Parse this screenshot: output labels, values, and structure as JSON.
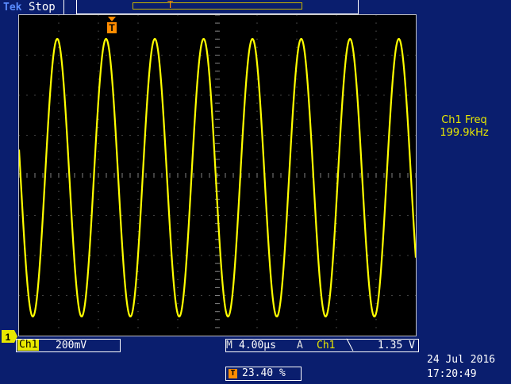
{
  "header": {
    "brand": "Tek",
    "run_status": "Stop",
    "record_marker": "T"
  },
  "display": {
    "trigger_marker": "T",
    "ch1_ground_marker": "1",
    "trace_color": "#ffff00",
    "grid_color": "#808080"
  },
  "measurement": {
    "label": "Ch1 Freq",
    "value": "199.9kHz"
  },
  "channel": {
    "label": "Ch1",
    "scale": "200mV",
    "color": "#e8e800"
  },
  "timebase": {
    "m_label": "M",
    "value": "4.00µs"
  },
  "trigger": {
    "a_label": "A",
    "source": "Ch1",
    "slope_icon": "falling-edge-icon",
    "slope_glyph": "╲",
    "level": "1.35 V",
    "position_icon": "T",
    "position_pct": "23.40 %"
  },
  "datetime": {
    "date": "24 Jul  2016",
    "time": "17:20:49"
  }
}
